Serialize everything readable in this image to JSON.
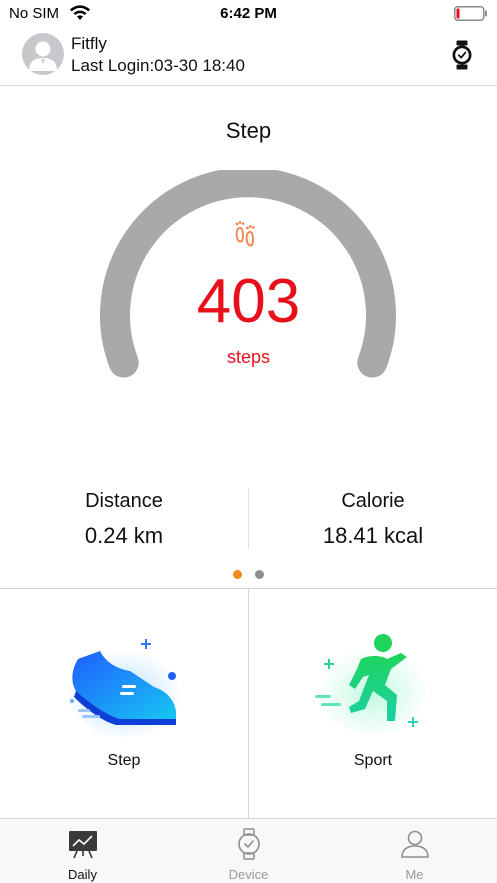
{
  "status_bar": {
    "carrier": "No SIM",
    "time": "6:42 PM"
  },
  "header": {
    "user_name": "Fitfly",
    "last_login": "Last Login:03-30 18:40"
  },
  "step_panel": {
    "title": "Step",
    "count": "403",
    "unit": "steps",
    "progress_fraction": 0.02
  },
  "stats": {
    "distance_label": "Distance",
    "distance_value": "0.24 km",
    "calorie_label": "Calorie",
    "calorie_value": "18.41 kcal"
  },
  "pager": {
    "pages": 2,
    "active": 0
  },
  "cards": {
    "step_label": "Step",
    "sport_label": "Sport"
  },
  "tabs": [
    {
      "label": "Daily",
      "icon": "chart-board-icon",
      "active": true
    },
    {
      "label": "Device",
      "icon": "watch-icon",
      "active": false
    },
    {
      "label": "Me",
      "icon": "person-icon",
      "active": false
    }
  ],
  "colors": {
    "accent_red": "#e8101b",
    "gauge_track": "#a9a9a9",
    "gauge_progress": "#f25b5b",
    "pager_active": "#f38b1c",
    "foot_icon": "#f2814a"
  }
}
